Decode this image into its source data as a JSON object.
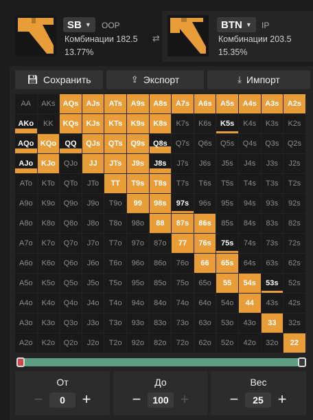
{
  "players": {
    "sb": {
      "position": "SB",
      "side": "OOP",
      "combos": "Комбинации 182.5",
      "percent": "13.77%"
    },
    "btn": {
      "position": "BTN",
      "side": "IP",
      "combos": "Комбинации 203.5",
      "percent": "15.35%"
    }
  },
  "toolbar": {
    "save_label": "Сохранить",
    "export_label": "Экспорт",
    "import_label": "Импорт"
  },
  "colors": {
    "accent": "#e89d38",
    "slider": "#5e9e82",
    "cell_empty": "#1a1a1a"
  },
  "grid": {
    "hands": [
      [
        "AA",
        "AKs",
        "AQs",
        "AJs",
        "ATs",
        "A9s",
        "A8s",
        "A7s",
        "A6s",
        "A5s",
        "A4s",
        "A3s",
        "A2s"
      ],
      [
        "AKo",
        "KK",
        "KQs",
        "KJs",
        "KTs",
        "K9s",
        "K8s",
        "K7s",
        "K6s",
        "K5s",
        "K4s",
        "K3s",
        "K2s"
      ],
      [
        "AQo",
        "KQo",
        "QQ",
        "QJs",
        "QTs",
        "Q9s",
        "Q8s",
        "Q7s",
        "Q6s",
        "Q5s",
        "Q4s",
        "Q3s",
        "Q2s"
      ],
      [
        "AJo",
        "KJo",
        "QJo",
        "JJ",
        "JTs",
        "J9s",
        "J8s",
        "J7s",
        "J6s",
        "J5s",
        "J4s",
        "J3s",
        "J2s"
      ],
      [
        "ATo",
        "KTo",
        "QTo",
        "JTo",
        "TT",
        "T9s",
        "T8s",
        "T7s",
        "T6s",
        "T5s",
        "T4s",
        "T3s",
        "T2s"
      ],
      [
        "A9o",
        "K9o",
        "Q9o",
        "J9o",
        "T9o",
        "99",
        "98s",
        "97s",
        "96s",
        "95s",
        "94s",
        "93s",
        "92s"
      ],
      [
        "A8o",
        "K8o",
        "Q8o",
        "J8o",
        "T8o",
        "98o",
        "88",
        "87s",
        "86s",
        "85s",
        "84s",
        "83s",
        "82s"
      ],
      [
        "A7o",
        "K7o",
        "Q7o",
        "J7o",
        "T7o",
        "97o",
        "87o",
        "77",
        "76s",
        "75s",
        "74s",
        "73s",
        "72s"
      ],
      [
        "A6o",
        "K6o",
        "Q6o",
        "J6o",
        "T6o",
        "96o",
        "86o",
        "76o",
        "66",
        "65s",
        "64s",
        "63s",
        "62s"
      ],
      [
        "A5o",
        "K5o",
        "Q5o",
        "J5o",
        "T5o",
        "95o",
        "85o",
        "75o",
        "65o",
        "55",
        "54s",
        "53s",
        "52s"
      ],
      [
        "A4o",
        "K4o",
        "Q4o",
        "J4o",
        "T4o",
        "94o",
        "84o",
        "74o",
        "64o",
        "54o",
        "44",
        "43s",
        "42s"
      ],
      [
        "A3o",
        "K3o",
        "Q3o",
        "J3o",
        "T3o",
        "93o",
        "83o",
        "73o",
        "63o",
        "53o",
        "43o",
        "33",
        "32s"
      ],
      [
        "A2o",
        "K2o",
        "Q2o",
        "J2o",
        "T2o",
        "92o",
        "82o",
        "72o",
        "62o",
        "52o",
        "42o",
        "32o",
        "22"
      ]
    ],
    "weights": [
      [
        0,
        0,
        1,
        1,
        1,
        1,
        1,
        1,
        1,
        1,
        1,
        1,
        1
      ],
      [
        0.25,
        0,
        1,
        1,
        1,
        1,
        1,
        0,
        0,
        0.1,
        0,
        0,
        0
      ],
      [
        0.25,
        1,
        0.25,
        1,
        1,
        1,
        0.35,
        0,
        0,
        0,
        0,
        0,
        0
      ],
      [
        0.25,
        1,
        0,
        1,
        1,
        1,
        0.25,
        0,
        0,
        0,
        0,
        0,
        0
      ],
      [
        0,
        0,
        0,
        0,
        1,
        1,
        1,
        0,
        0,
        0,
        0,
        0,
        0
      ],
      [
        0,
        0,
        0,
        0,
        0,
        1,
        1,
        0.1,
        0,
        0,
        0,
        0,
        0
      ],
      [
        0,
        0,
        0,
        0,
        0,
        0,
        1,
        1,
        1,
        0,
        0,
        0,
        0
      ],
      [
        0,
        0,
        0,
        0,
        0,
        0,
        0,
        1,
        1,
        0.1,
        0,
        0,
        0
      ],
      [
        0,
        0,
        0,
        0,
        0,
        0,
        0,
        0,
        1,
        1,
        0,
        0,
        0
      ],
      [
        0,
        0,
        0,
        0,
        0,
        0,
        0,
        0,
        0,
        1,
        1,
        0.1,
        0
      ],
      [
        0,
        0,
        0,
        0,
        0,
        0,
        0,
        0,
        0,
        0,
        1,
        0,
        0
      ],
      [
        0,
        0,
        0,
        0,
        0,
        0,
        0,
        0,
        0,
        0,
        0,
        1,
        0
      ],
      [
        0,
        0,
        0,
        0,
        0,
        0,
        0,
        0,
        0,
        0,
        0,
        0,
        1
      ]
    ]
  },
  "range_slider": {
    "from_percent": 0,
    "to_percent": 100
  },
  "controls": {
    "from": {
      "label": "От",
      "value": "0"
    },
    "to": {
      "label": "До",
      "value": "100"
    },
    "weight": {
      "label": "Вес",
      "value": "25"
    }
  }
}
